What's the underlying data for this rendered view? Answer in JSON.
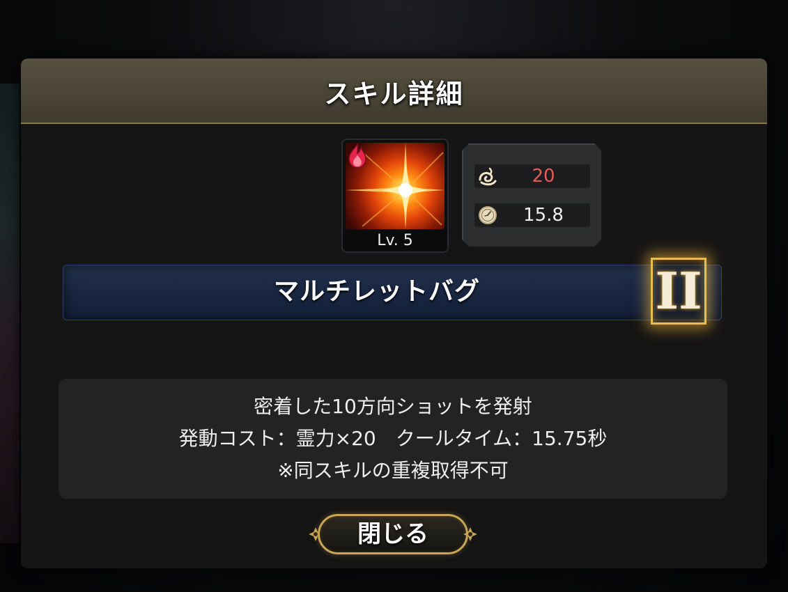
{
  "dialog": {
    "title": "スキル詳細"
  },
  "skill": {
    "level_label": "Lv. 5",
    "element_icon": "fire-icon",
    "name": "マルチレットバグ",
    "rank": "II"
  },
  "stats": {
    "cost_icon": "spirit-swirl-icon",
    "cost_value": "20",
    "cooldown_icon": "clock-icon",
    "cooldown_value": "15.8"
  },
  "description": {
    "line1": "密着した10方向ショットを発射",
    "line2": "発動コスト：霊力×20　クールタイム：15.75秒",
    "line3": "※同スキルの重複取得不可"
  },
  "buttons": {
    "close_label": "閉じる"
  },
  "colors": {
    "header_bg": "#4a4536",
    "header_border": "#8a7a4e",
    "cost_text": "#e65a55",
    "rank_glow": "#e9bd52",
    "name_bar_bg": "#1a2742",
    "button_border": "#c9a656"
  }
}
